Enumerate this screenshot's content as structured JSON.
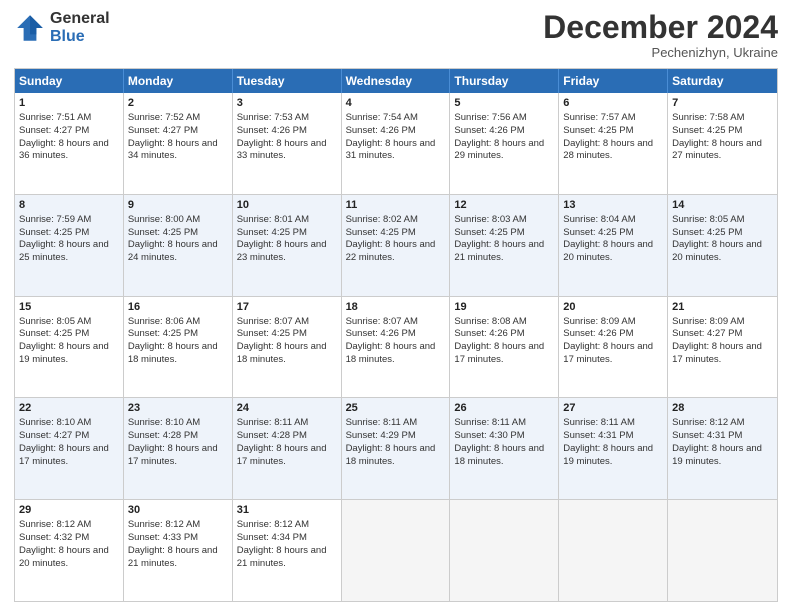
{
  "logo": {
    "general": "General",
    "blue": "Blue"
  },
  "header": {
    "month": "December 2024",
    "location": "Pechenizhyn, Ukraine"
  },
  "days": [
    "Sunday",
    "Monday",
    "Tuesday",
    "Wednesday",
    "Thursday",
    "Friday",
    "Saturday"
  ],
  "weeks": [
    [
      {
        "day": "1",
        "sunrise": "7:51 AM",
        "sunset": "4:27 PM",
        "daylight": "8 hours and 36 minutes."
      },
      {
        "day": "2",
        "sunrise": "7:52 AM",
        "sunset": "4:27 PM",
        "daylight": "8 hours and 34 minutes."
      },
      {
        "day": "3",
        "sunrise": "7:53 AM",
        "sunset": "4:26 PM",
        "daylight": "8 hours and 33 minutes."
      },
      {
        "day": "4",
        "sunrise": "7:54 AM",
        "sunset": "4:26 PM",
        "daylight": "8 hours and 31 minutes."
      },
      {
        "day": "5",
        "sunrise": "7:56 AM",
        "sunset": "4:26 PM",
        "daylight": "8 hours and 29 minutes."
      },
      {
        "day": "6",
        "sunrise": "7:57 AM",
        "sunset": "4:25 PM",
        "daylight": "8 hours and 28 minutes."
      },
      {
        "day": "7",
        "sunrise": "7:58 AM",
        "sunset": "4:25 PM",
        "daylight": "8 hours and 27 minutes."
      }
    ],
    [
      {
        "day": "8",
        "sunrise": "7:59 AM",
        "sunset": "4:25 PM",
        "daylight": "8 hours and 25 minutes."
      },
      {
        "day": "9",
        "sunrise": "8:00 AM",
        "sunset": "4:25 PM",
        "daylight": "8 hours and 24 minutes."
      },
      {
        "day": "10",
        "sunrise": "8:01 AM",
        "sunset": "4:25 PM",
        "daylight": "8 hours and 23 minutes."
      },
      {
        "day": "11",
        "sunrise": "8:02 AM",
        "sunset": "4:25 PM",
        "daylight": "8 hours and 22 minutes."
      },
      {
        "day": "12",
        "sunrise": "8:03 AM",
        "sunset": "4:25 PM",
        "daylight": "8 hours and 21 minutes."
      },
      {
        "day": "13",
        "sunrise": "8:04 AM",
        "sunset": "4:25 PM",
        "daylight": "8 hours and 20 minutes."
      },
      {
        "day": "14",
        "sunrise": "8:05 AM",
        "sunset": "4:25 PM",
        "daylight": "8 hours and 20 minutes."
      }
    ],
    [
      {
        "day": "15",
        "sunrise": "8:05 AM",
        "sunset": "4:25 PM",
        "daylight": "8 hours and 19 minutes."
      },
      {
        "day": "16",
        "sunrise": "8:06 AM",
        "sunset": "4:25 PM",
        "daylight": "8 hours and 18 minutes."
      },
      {
        "day": "17",
        "sunrise": "8:07 AM",
        "sunset": "4:25 PM",
        "daylight": "8 hours and 18 minutes."
      },
      {
        "day": "18",
        "sunrise": "8:07 AM",
        "sunset": "4:26 PM",
        "daylight": "8 hours and 18 minutes."
      },
      {
        "day": "19",
        "sunrise": "8:08 AM",
        "sunset": "4:26 PM",
        "daylight": "8 hours and 17 minutes."
      },
      {
        "day": "20",
        "sunrise": "8:09 AM",
        "sunset": "4:26 PM",
        "daylight": "8 hours and 17 minutes."
      },
      {
        "day": "21",
        "sunrise": "8:09 AM",
        "sunset": "4:27 PM",
        "daylight": "8 hours and 17 minutes."
      }
    ],
    [
      {
        "day": "22",
        "sunrise": "8:10 AM",
        "sunset": "4:27 PM",
        "daylight": "8 hours and 17 minutes."
      },
      {
        "day": "23",
        "sunrise": "8:10 AM",
        "sunset": "4:28 PM",
        "daylight": "8 hours and 17 minutes."
      },
      {
        "day": "24",
        "sunrise": "8:11 AM",
        "sunset": "4:28 PM",
        "daylight": "8 hours and 17 minutes."
      },
      {
        "day": "25",
        "sunrise": "8:11 AM",
        "sunset": "4:29 PM",
        "daylight": "8 hours and 18 minutes."
      },
      {
        "day": "26",
        "sunrise": "8:11 AM",
        "sunset": "4:30 PM",
        "daylight": "8 hours and 18 minutes."
      },
      {
        "day": "27",
        "sunrise": "8:11 AM",
        "sunset": "4:31 PM",
        "daylight": "8 hours and 19 minutes."
      },
      {
        "day": "28",
        "sunrise": "8:12 AM",
        "sunset": "4:31 PM",
        "daylight": "8 hours and 19 minutes."
      }
    ],
    [
      {
        "day": "29",
        "sunrise": "8:12 AM",
        "sunset": "4:32 PM",
        "daylight": "8 hours and 20 minutes."
      },
      {
        "day": "30",
        "sunrise": "8:12 AM",
        "sunset": "4:33 PM",
        "daylight": "8 hours and 21 minutes."
      },
      {
        "day": "31",
        "sunrise": "8:12 AM",
        "sunset": "4:34 PM",
        "daylight": "8 hours and 21 minutes."
      },
      null,
      null,
      null,
      null
    ]
  ],
  "labels": {
    "sunrise": "Sunrise:",
    "sunset": "Sunset:",
    "daylight": "Daylight:"
  }
}
